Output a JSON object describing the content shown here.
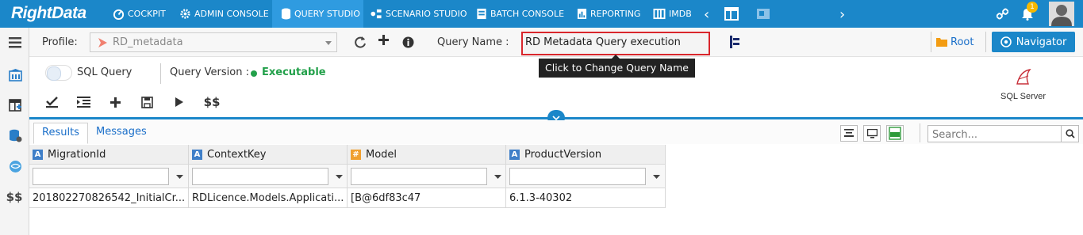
{
  "nav": {
    "logo": "RightData",
    "items": [
      {
        "label": "COCKPIT",
        "icon": "dashboard-icon"
      },
      {
        "label": "ADMIN CONSOLE",
        "icon": "gear-icon"
      },
      {
        "label": "QUERY STUDIO",
        "icon": "database-icon"
      },
      {
        "label": "SCENARIO STUDIO",
        "icon": "scenario-icon"
      },
      {
        "label": "BATCH CONSOLE",
        "icon": "batch-icon"
      },
      {
        "label": "REPORTING",
        "icon": "report-icon"
      },
      {
        "label": "IMDB",
        "icon": "imdb-icon"
      }
    ],
    "notification_count": "1"
  },
  "toolbar": {
    "profile_label": "Profile:",
    "profile_value": "RD_metadata",
    "query_name_label": "Query Name :",
    "query_name_value": "RD Metadata Query execution",
    "tooltip": "Click to Change Query Name",
    "root_label": "Root",
    "navigator_label": "Navigator"
  },
  "editor": {
    "sql_query_label": "SQL Query",
    "query_version_label": "Query Version :",
    "query_version_status": "Executable",
    "status_color": "#22a04a",
    "sql_server_label": "SQL Server",
    "dollar_label": "$$"
  },
  "results": {
    "tabs": [
      "Results",
      "Messages"
    ],
    "search_placeholder": "Search...",
    "columns": [
      {
        "type": "A",
        "name": "MigrationId"
      },
      {
        "type": "A",
        "name": "ContextKey"
      },
      {
        "type": "#",
        "name": "Model"
      },
      {
        "type": "A",
        "name": "ProductVersion"
      }
    ],
    "rows": [
      [
        "201802270826542_InitialCr...",
        "RDLicence.Models.Applicati...",
        "[B@6df83c47",
        "6.1.3-40302"
      ]
    ]
  },
  "sidebar": {
    "dollar_label": "$$"
  },
  "colors": {
    "primary": "#1b87c9",
    "highlight_border": "#d9262c",
    "notification": "#f5b800"
  }
}
